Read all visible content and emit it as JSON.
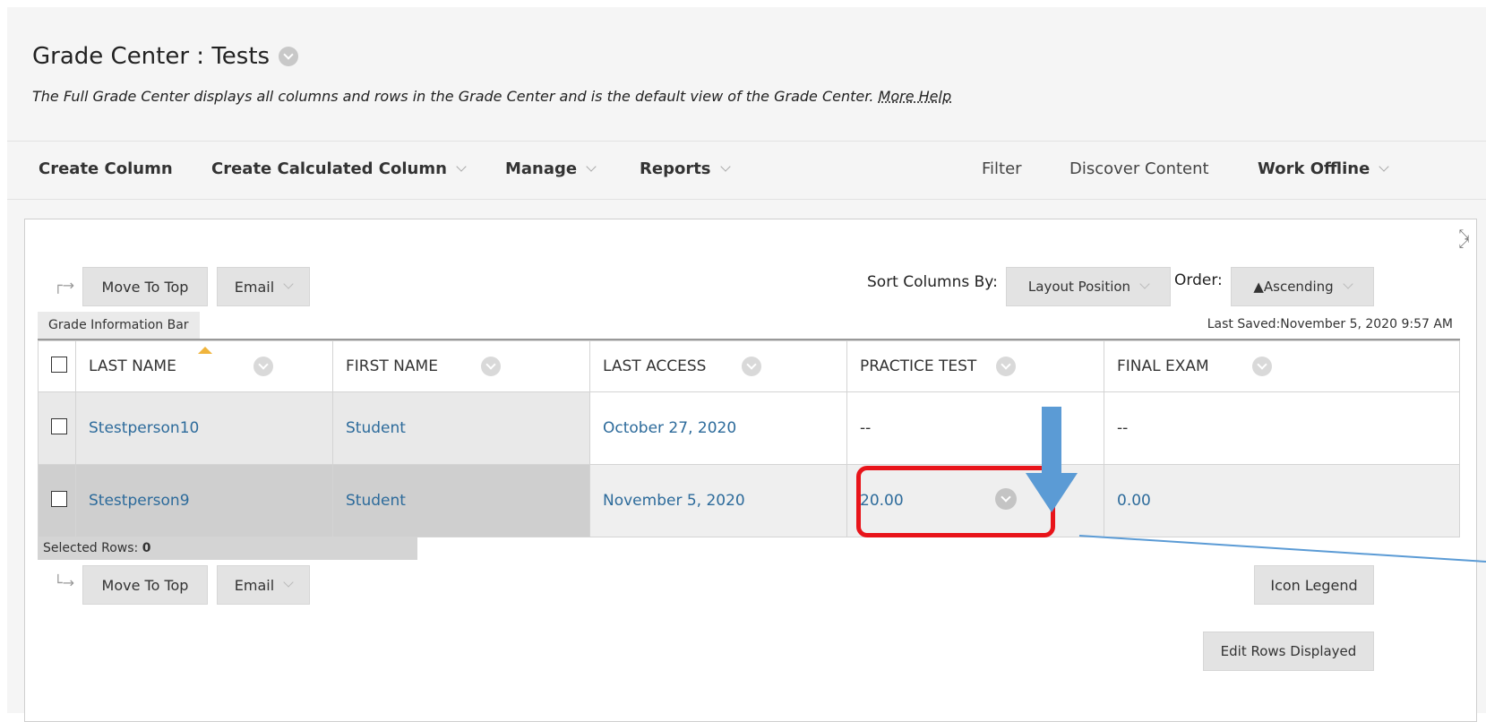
{
  "header": {
    "title": "Grade Center : Tests",
    "subtitle": "The Full Grade Center displays all columns and rows in the Grade Center and is the default view of the Grade Center.",
    "help_link": "More Help"
  },
  "actionbar": {
    "create_column": "Create Column",
    "create_calculated": "Create Calculated Column",
    "manage": "Manage",
    "reports": "Reports",
    "filter": "Filter",
    "discover": "Discover Content",
    "work_offline": "Work Offline"
  },
  "toolbar": {
    "move_to_top": "Move To Top",
    "email": "Email",
    "sort_label": "Sort Columns By:",
    "sort_value": "Layout Position",
    "order_label": "Order:",
    "order_value": "▲Ascending"
  },
  "infobar": {
    "tab": "Grade Information Bar",
    "last_saved": "Last Saved:November 5, 2020 9:57 AM"
  },
  "table": {
    "columns": [
      "LAST NAME",
      "FIRST NAME",
      "LAST ACCESS",
      "PRACTICE TEST",
      "FINAL EXAM"
    ],
    "rows": [
      {
        "last": "Stestperson10",
        "first": "Student",
        "access": "October 27, 2020",
        "practice": "--",
        "final": "--"
      },
      {
        "last": "Stestperson9",
        "first": "Student",
        "access": "November 5, 2020",
        "practice": "20.00",
        "final": "0.00"
      }
    ]
  },
  "footer": {
    "selected_label": "Selected Rows:",
    "selected_count": "0",
    "move_to_top": "Move To Top",
    "email": "Email",
    "icon_legend": "Icon Legend",
    "edit_rows": "Edit Rows Displayed"
  },
  "colors": {
    "link": "#2d6b9b",
    "highlight": "#e8141a",
    "annotation_arrow": "#5b9bd5"
  }
}
